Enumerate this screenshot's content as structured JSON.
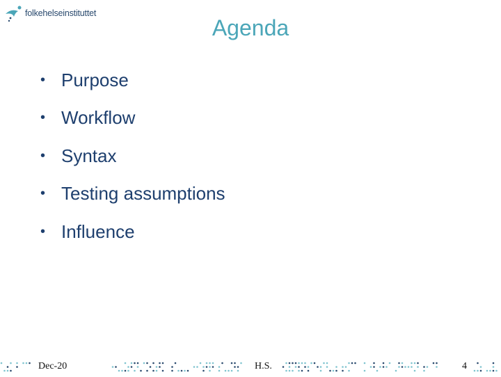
{
  "logo": {
    "text": "folkehelseinstituttet",
    "icon": "fhi-logo-icon"
  },
  "slide": {
    "title": "Agenda",
    "items": [
      "Purpose",
      "Workflow",
      "Syntax",
      "Testing assumptions",
      "Influence"
    ]
  },
  "footer": {
    "date": "Dec-20",
    "author": "H.S.",
    "page_number": "4"
  },
  "colors": {
    "title": "#4ba6b8",
    "body": "#1e3f6e",
    "dot_light": "#7fc4cf",
    "dot_dark": "#2a4a6e"
  }
}
